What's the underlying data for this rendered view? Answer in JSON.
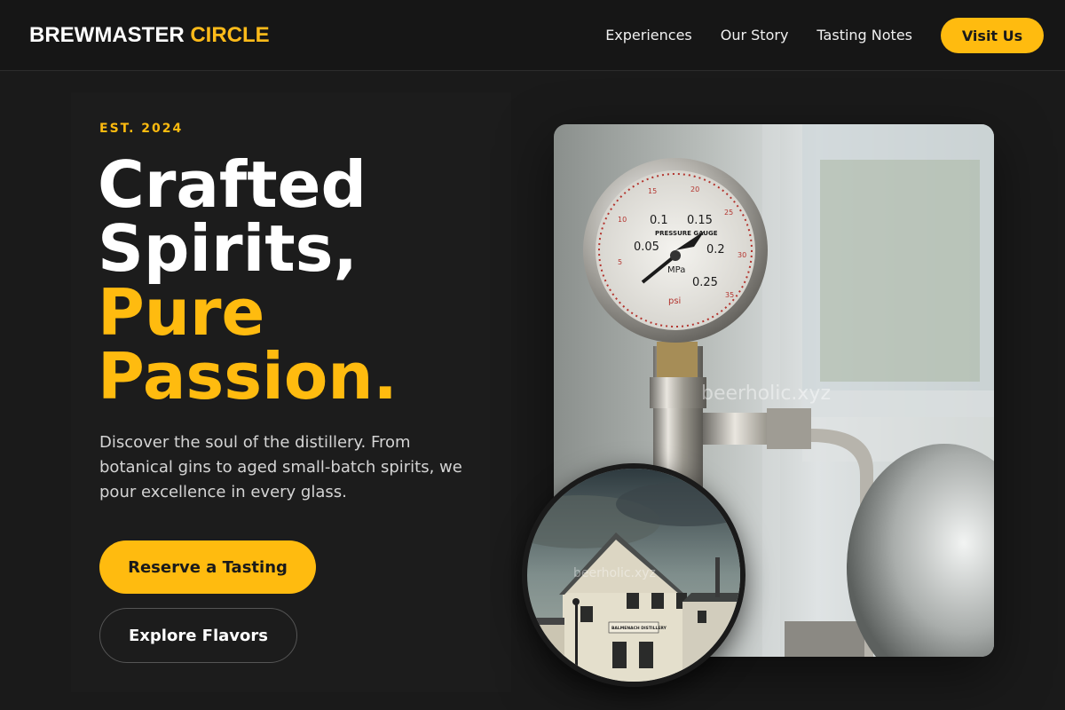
{
  "header": {
    "brand_primary": "BREWMASTER",
    "brand_accent": "CIRCLE",
    "nav": [
      {
        "label": "Experiences"
      },
      {
        "label": "Our Story"
      },
      {
        "label": "Tasting Notes"
      }
    ],
    "cta_label": "Visit Us"
  },
  "hero": {
    "eyebrow": "EST. 2024",
    "headline_line1": "Crafted",
    "headline_line2": "Spirits,",
    "headline_line3": "Pure",
    "headline_line4": "Passion.",
    "description": "Discover the soul of the distillery. From botanical gins to aged small-batch spirits, we pour excellence in every glass.",
    "primary_button": "Reserve a Tasting",
    "secondary_button": "Explore Flavors"
  },
  "images": {
    "main": {
      "gauge_labels": {
        "mpa_ticks": [
          "0.05",
          "0.1",
          "0.15",
          "0.2",
          "0.25"
        ],
        "psi_ticks": [
          "5",
          "10",
          "15",
          "20",
          "25",
          "30",
          "35"
        ],
        "dial_text": "PRESSURE GAUGE",
        "unit_mpa": "MPa",
        "unit_psi": "psi"
      },
      "watermark": "beerholic.xyz"
    },
    "inset": {
      "sign_text": "BALMENACH DISTILLERY",
      "watermark": "beerholic.xyz"
    }
  },
  "colors": {
    "accent": "#ffbb0f",
    "background": "#1a1a1a"
  }
}
